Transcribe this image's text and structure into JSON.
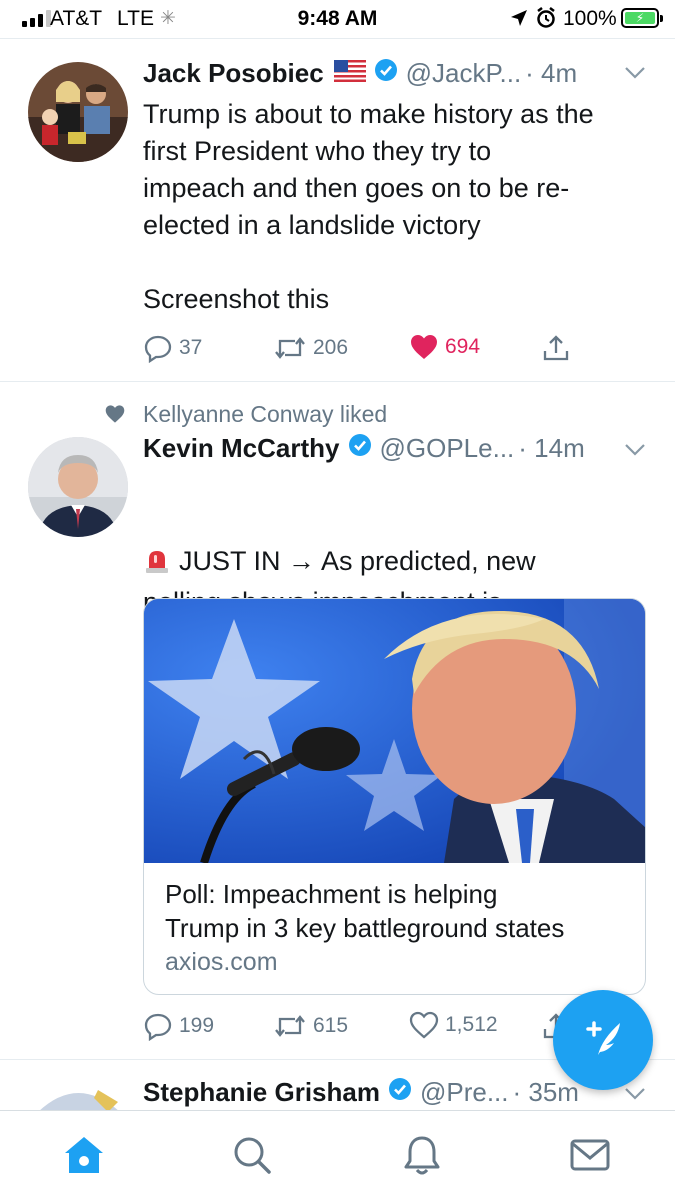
{
  "status_bar": {
    "carrier": "AT&T",
    "network": "LTE",
    "time": "9:48 AM",
    "battery": "100%"
  },
  "tweets": [
    {
      "name": "Jack Posobiec",
      "handle": "@JackP...",
      "time": "· 4m",
      "text": "Trump is about to make history as the\nfirst President who they try to\nimpeach and then goes on to be re-\nelected in a landslide victory\n\nScreenshot this",
      "replies": "37",
      "retweets": "206",
      "likes": "694"
    },
    {
      "social_context": "Kellyanne Conway liked",
      "name": "Kevin McCarthy",
      "handle": "@GOPLe...",
      "time": "· 14m",
      "text_prefix": "JUST IN →",
      "text": "As predicted, new\npolling shows impeachment is\nbackfiring on Democrats.",
      "card": {
        "title": "Poll: Impeachment is helping\nTrump in 3 key battleground states",
        "domain": "axios.com"
      },
      "replies": "199",
      "retweets": "615",
      "likes": "1,512"
    },
    {
      "name": "Stephanie Grisham",
      "handle": "@Pre...",
      "time": "· 35m"
    }
  ],
  "colors": {
    "twitter_blue": "#1da1f2",
    "like_red": "#e0245e",
    "gray_text": "#657786"
  }
}
